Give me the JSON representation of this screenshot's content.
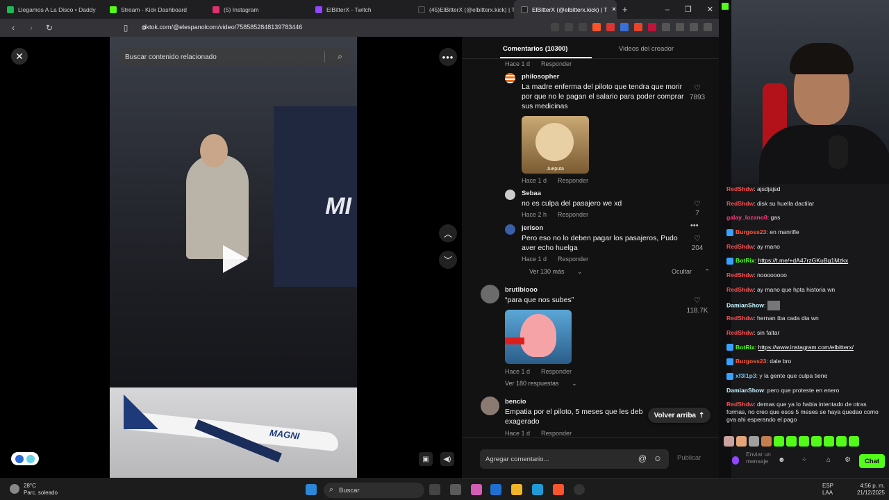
{
  "browser": {
    "tabs": [
      {
        "label": "Llegamos A La Disco • Daddy",
        "color": "#1db954"
      },
      {
        "label": "Stream - Kick Dashboard",
        "color": "#53fc18"
      },
      {
        "label": "(5) Instagram",
        "color": "#e1306c"
      },
      {
        "label": "ElBitterX - Twitch",
        "color": "#9146ff"
      },
      {
        "label": "(45)ElBitterX (@elbitterx.kick) | Ti",
        "color": "#222222"
      },
      {
        "label": "ElBitterX (@elbitterx.kick) | T",
        "color": "#222222"
      }
    ],
    "url": "tiktok.com/@elespanolcom/video/7585852848139783446",
    "win_controls": [
      "–",
      "❐",
      "✕"
    ]
  },
  "video": {
    "search_placeholder": "Buscar contenido relacionado",
    "overlay_text": "MI"
  },
  "comments_panel": {
    "tab_comments": "Comentarios (10300)",
    "tab_creator": "Videos del creador",
    "top_meta": {
      "time": "Hace 1 d",
      "reply": "Responder"
    },
    "items": [
      {
        "user": "philosopher",
        "text": "La madre enferma del piloto que tendra que morir por que no le pagan el salario para poder comprar sus medicinas",
        "likes": "7893",
        "sticker_caption": "Jueputa",
        "time": "Hace 1 d",
        "reply": "Responder"
      },
      {
        "user": "Sebaa",
        "text": "no es culpa del pasajero we xd",
        "likes": "7",
        "time": "Hace 2 h",
        "reply": "Responder"
      },
      {
        "user": "jerison",
        "text": "Pero eso no lo deben pagar los pasajeros, Pudo aver echo huelga",
        "likes": "204",
        "time": "Hace 1 d",
        "reply": "Responder"
      },
      {
        "user": "brutlbiooo",
        "text": "“para que nos subes”",
        "likes": "118.7K",
        "time": "Hace 1 d",
        "reply": "Responder"
      },
      {
        "user": "bencio",
        "text": "Empatia por el piloto, 5 meses que les deb exagerado",
        "likes": "",
        "time": "Hace 1 d",
        "reply": "Responder"
      }
    ],
    "view_more": "Ver 130 más",
    "hide": "Ocultar",
    "view_replies": "Ver 180 respuestas",
    "back_to_top": "Volver arriba",
    "add_placeholder": "Agregar comentario...",
    "publish": "Publicar"
  },
  "stream_chat": {
    "messages": [
      {
        "user": "RedShdw",
        "color": "#ff4d4d",
        "text": "ajsdjajsd"
      },
      {
        "user": "RedShdw",
        "color": "#ff4d4d",
        "text": "disk su huella dactilar"
      },
      {
        "user": "galay_lozano8",
        "color": "#ff3b7b",
        "text": "gas"
      },
      {
        "user": "Burgoss23",
        "color": "#ff5a36",
        "text": "en manrifle",
        "badge": "#3aa0ff"
      },
      {
        "user": "RedShdw",
        "color": "#ff4d4d",
        "text": "ay mano"
      },
      {
        "user": "BotRix",
        "color": "#53fc18",
        "text": "https://t.me/+dA47rzGKuBg1Mzkx",
        "link": true,
        "badge": "#3aa0ff"
      },
      {
        "user": "RedShdw",
        "color": "#ff4d4d",
        "text": "noooooooo"
      },
      {
        "user": "RedShdw",
        "color": "#ff4d4d",
        "text": "ay mano que hpta historia wn"
      },
      {
        "user": "DamianShow",
        "color": "#c7f5ff",
        "text": ""
      },
      {
        "user": "RedShdw",
        "color": "#ff4d4d",
        "text": "hernan iba cada dia wn"
      },
      {
        "user": "RedShdw",
        "color": "#ff4d4d",
        "text": "sin faltar"
      },
      {
        "user": "BotRix",
        "color": "#53fc18",
        "text": "https://www.instagram.com/elbitterx/",
        "link": true,
        "badge": "#3aa0ff"
      },
      {
        "user": "Burgoss23",
        "color": "#ff5a36",
        "text": "dale bro",
        "badge": "#3aa0ff"
      },
      {
        "user": "xf3l1p3",
        "color": "#5ac8ff",
        "text": "y la gente que culpa tiene",
        "badge": "#3aa0ff"
      },
      {
        "user": "DamianShow",
        "color": "#c7f5ff",
        "text": "pero que proteste en enero"
      },
      {
        "user": "RedShdw",
        "color": "#ff4d4d",
        "text": "demas que ya lo habia intentado de otras formas, no creo que esos 5 meses se haya quedao como gva ahi esperando el pago",
        "wrap": true
      }
    ],
    "input_placeholder": "Enviar un mensaje",
    "chat_button": "Chat"
  },
  "taskbar": {
    "weather_temp": "28°C",
    "weather_desc": "Parc. soleado",
    "search": "Buscar",
    "lang": "ESP",
    "lang2": "LAA",
    "time": "4:56 p. m.",
    "date": "21/12/2025"
  }
}
